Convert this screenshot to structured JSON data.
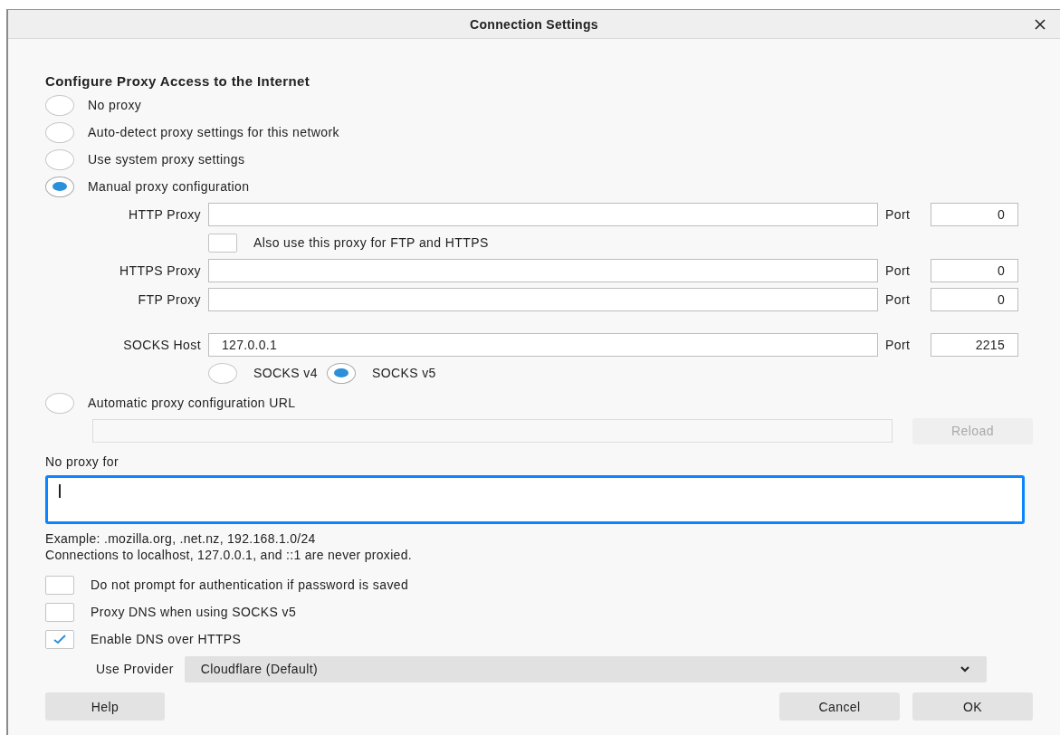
{
  "window": {
    "title": "Connection Settings"
  },
  "heading": "Configure Proxy Access to the Internet",
  "modes": [
    {
      "kind": "plain",
      "label": "No proxy",
      "selected": false
    },
    {
      "kind": "plain",
      "label": "Auto-detect proxy settings for this network",
      "selected": false
    },
    {
      "kind": "plain",
      "label": "Use system proxy settings",
      "selected": false
    },
    {
      "kind": "manual",
      "label": "Manual proxy configuration",
      "selected": true
    },
    {
      "kind": "auto_url",
      "label": "Automatic proxy configuration URL",
      "selected": false
    }
  ],
  "manual": {
    "proxies": [
      {
        "label": "HTTP Proxy",
        "port_label": "Port",
        "port": "0"
      }
    ],
    "also_use": {
      "label": "Also use this proxy for FTP and HTTPS",
      "checked": false
    },
    "more_proxies": [
      {
        "label": "HTTPS Proxy",
        "port_label": "Port",
        "port": "0"
      },
      {
        "label": "FTP Proxy",
        "port_label": "Port",
        "port": "0"
      }
    ],
    "socks": {
      "label": "SOCKS Host",
      "value": "127.0.0.1",
      "port_label": "Port",
      "port": "2215"
    },
    "socks_versions": [
      {
        "label": "SOCKS v4",
        "selected": false
      },
      {
        "label": "SOCKS v5",
        "selected": true
      }
    ]
  },
  "auto_url": {
    "disabled": true,
    "reload": {
      "label": "Reload",
      "disabled": true
    }
  },
  "no_proxy": {
    "label": "No proxy for",
    "focused": true,
    "example": "Example: .mozilla.org, .net.nz, 192.168.1.0/24",
    "note": "Connections to localhost, 127.0.0.1, and ::1 are never proxied."
  },
  "options": [
    {
      "label": "Do not prompt for authentication if password is saved",
      "checked": false
    },
    {
      "label": "Proxy DNS when using SOCKS v5",
      "checked": false
    },
    {
      "label": "Enable DNS over HTTPS",
      "checked": true
    }
  ],
  "provider": {
    "label": "Use Provider",
    "value": "Cloudflare (Default)"
  },
  "buttons": {
    "help": "Help",
    "cancel": "Cancel",
    "ok": "OK"
  }
}
